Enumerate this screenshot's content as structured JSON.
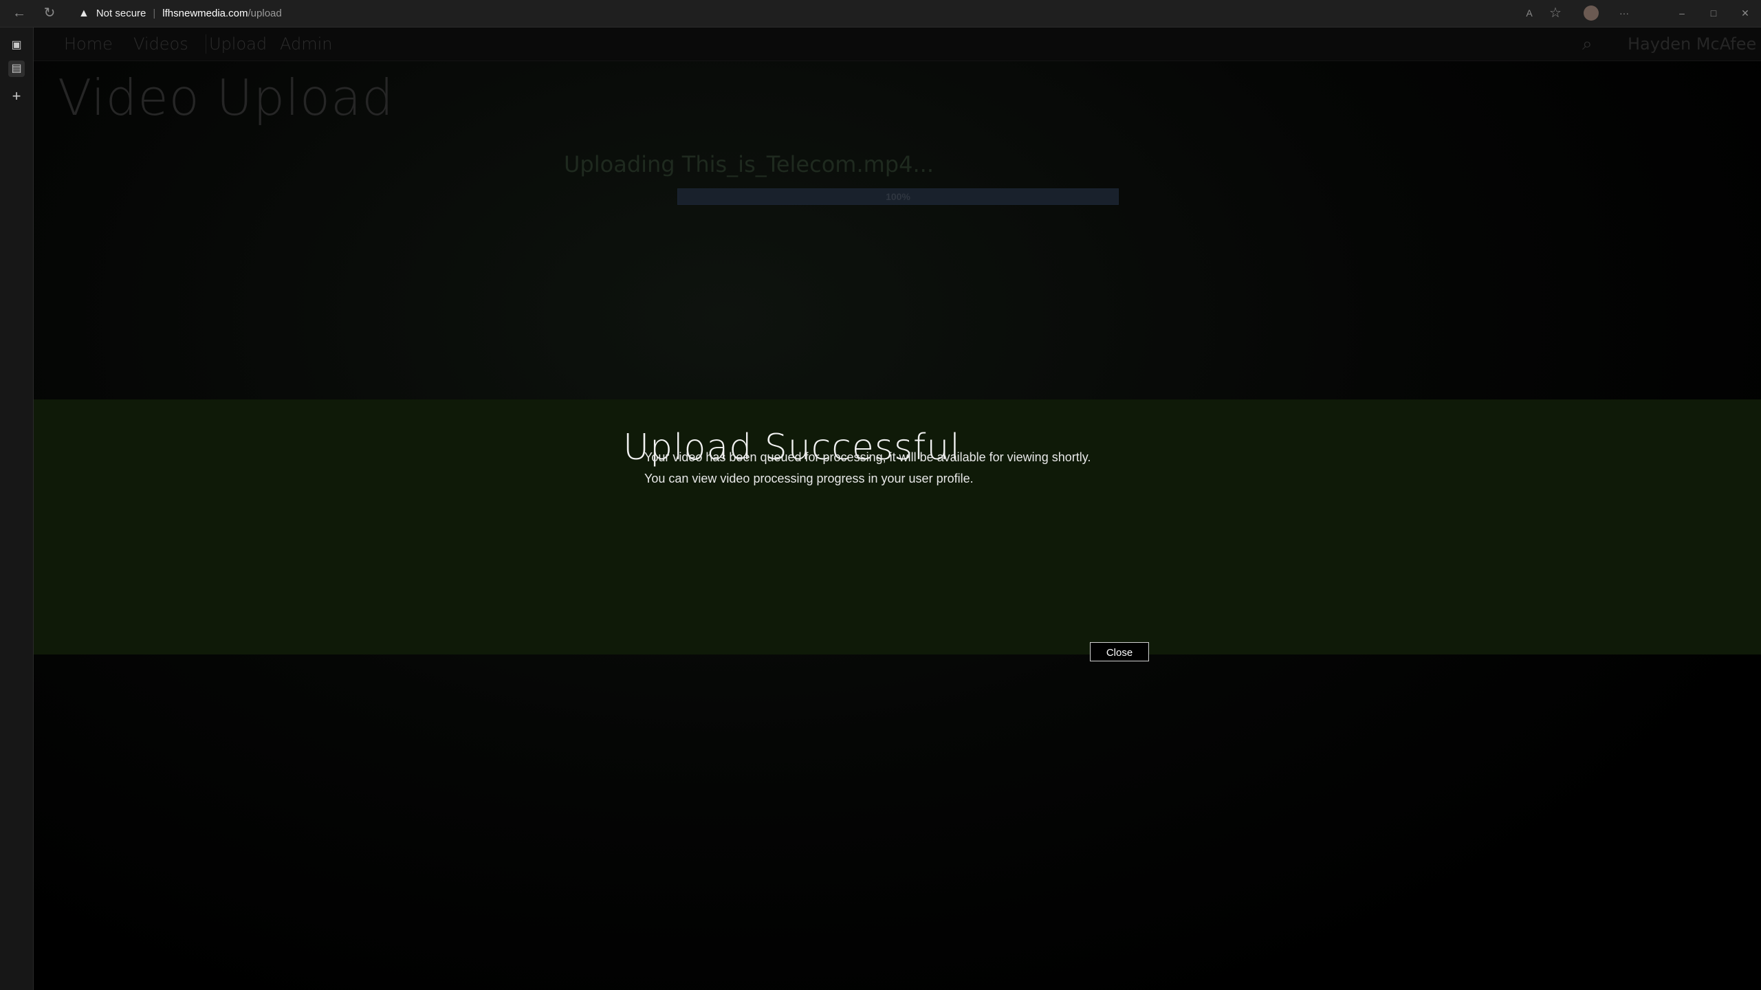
{
  "browser": {
    "security_label": "Not secure",
    "url_host": "lfhsnewmedia.com",
    "url_path": "/upload",
    "back_icon": "←",
    "refresh_icon": "↻",
    "warning_icon": "▲",
    "read_aloud_icon": "A",
    "favorites_icon": "☆",
    "more_icon": "···",
    "minimize_icon": "–",
    "maximize_icon": "□",
    "close_icon": "✕"
  },
  "sidebar": {
    "tabs_icon": "▣",
    "page_icon": "▤",
    "new_tab_icon": "+"
  },
  "nav": {
    "items": [
      {
        "label": "Home"
      },
      {
        "label": "Videos"
      },
      {
        "label": "Upload"
      },
      {
        "label": "Admin"
      }
    ],
    "search_icon": "⌕",
    "user_name": "Hayden McAfee"
  },
  "page": {
    "title": "Video Upload",
    "upload_status": "Uploading This_is_Telecom.mp4...",
    "progress_label": "100%",
    "progress_value": 1.0
  },
  "dialog": {
    "title": "Upload Successful",
    "line1": "Your video has been queued for processing, it will be available for viewing shortly.",
    "line2": "You can view video processing progress in your user profile.",
    "close_label": "Close"
  }
}
